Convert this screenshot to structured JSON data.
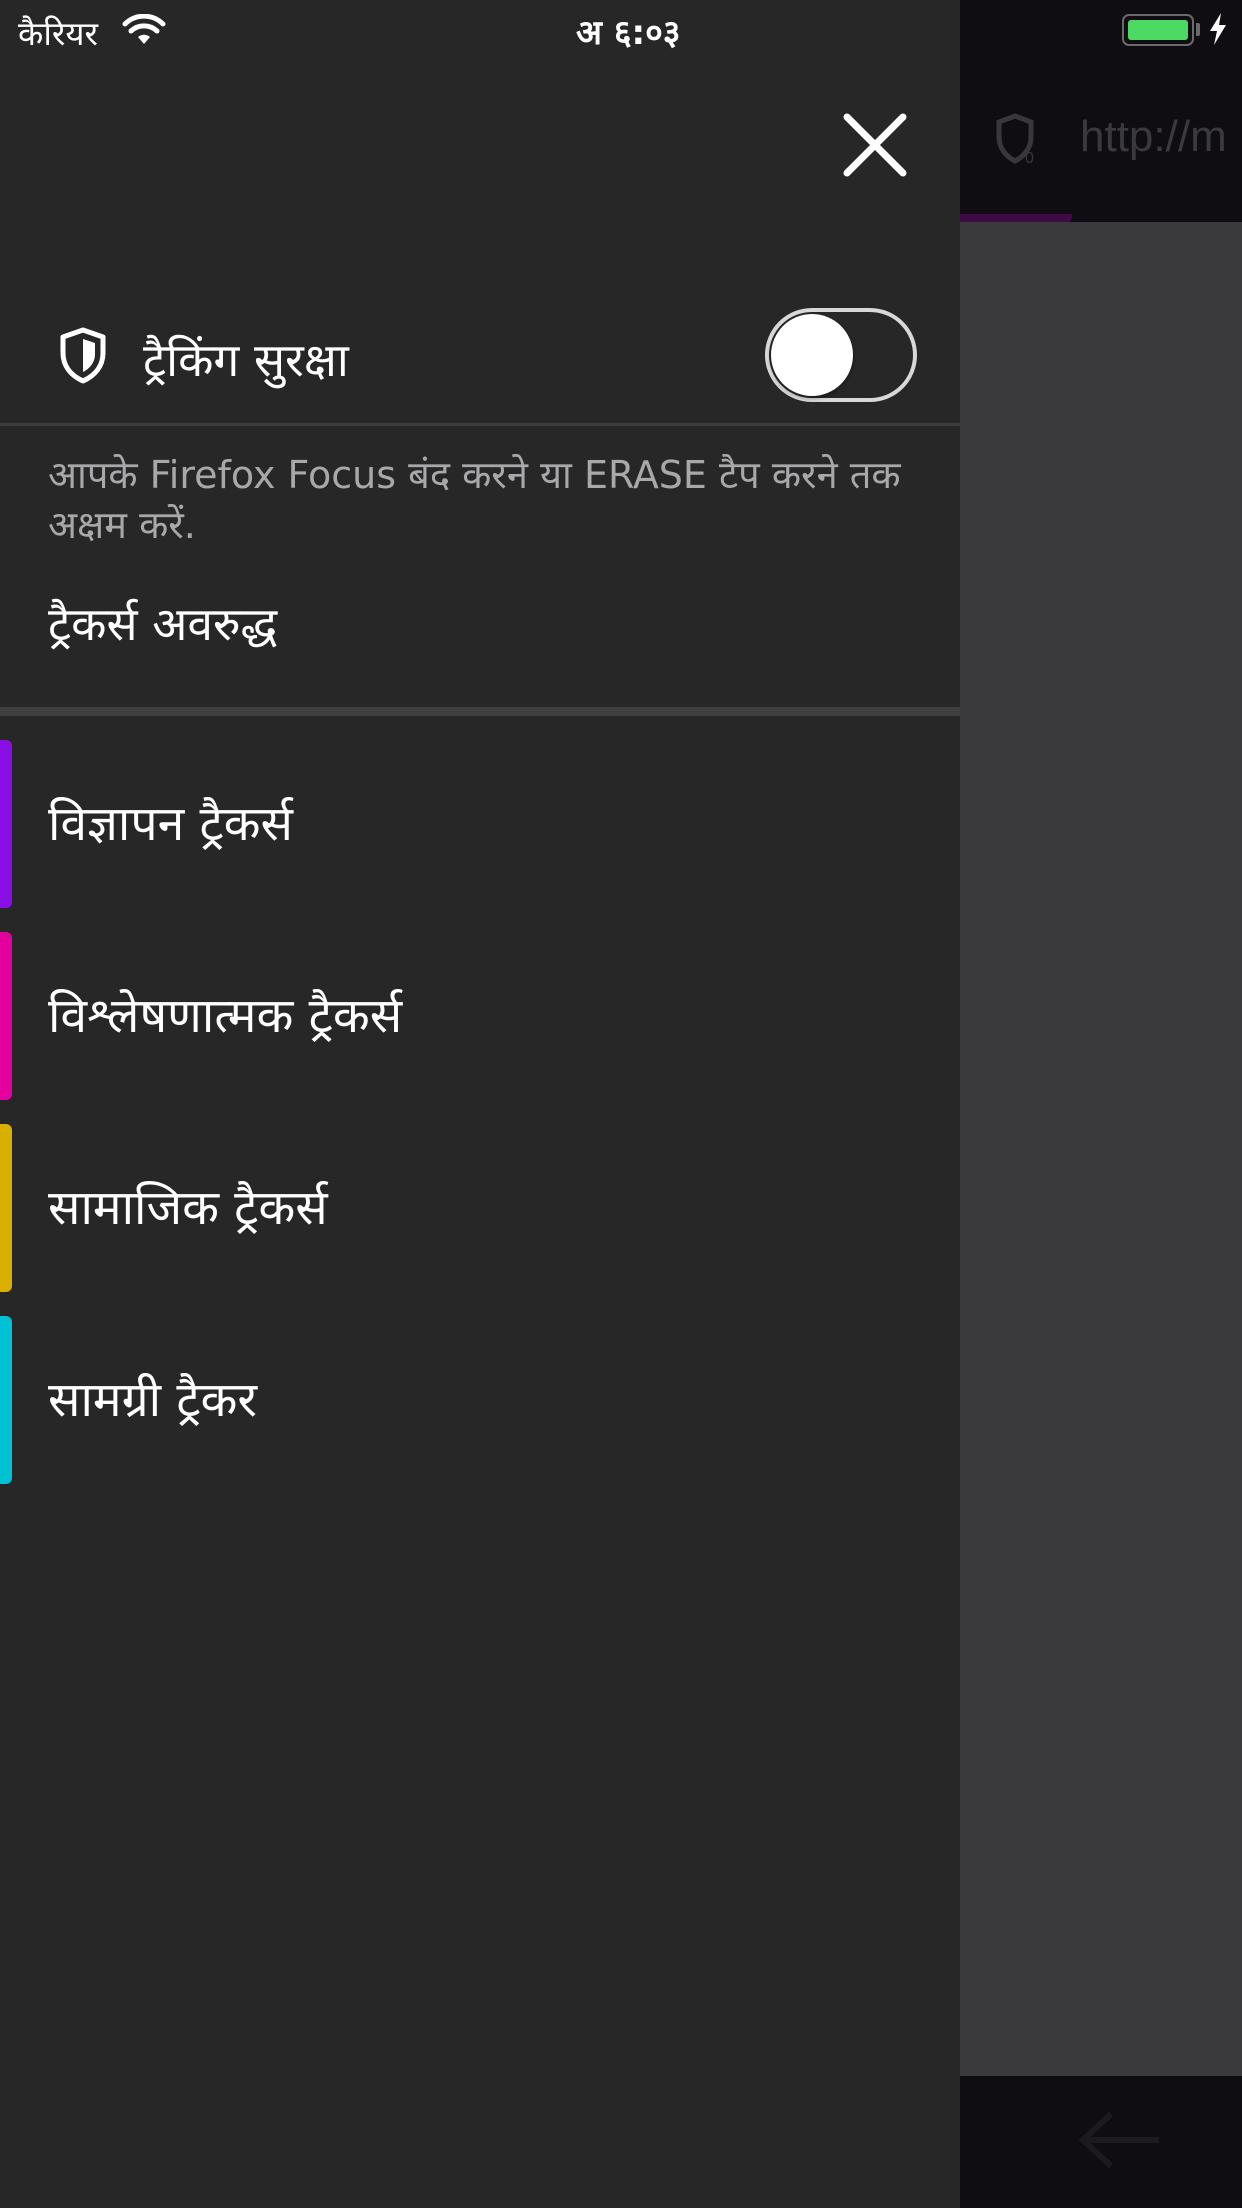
{
  "status_bar": {
    "carrier": "कैरियर",
    "time": "अ ६:०३"
  },
  "background_browser": {
    "url_text": "http://m"
  },
  "panel": {
    "tracking_protection_label": "ट्रैकिंग सुरक्षा",
    "tracking_protection_enabled": false,
    "description": "आपके Firefox Focus बंद करने या ERASE टैप करने तक अक्षम करें.",
    "trackers_blocked_label": "ट्रैकर्स अवरुद्ध",
    "trackers": [
      {
        "label": "विज्ञापन ट्रैकर्स",
        "color": "#8a0fe6"
      },
      {
        "label": "विश्लेषणात्मक ट्रैकर्स",
        "color": "#e4009f"
      },
      {
        "label": "सामाजिक ट्रैकर्स",
        "color": "#d8b100"
      },
      {
        "label": "सामग्री ट्रैकर",
        "color": "#00c2d4"
      }
    ]
  },
  "colors": {
    "panel_bg": "#272727",
    "battery": "#4cd964"
  },
  "icons": [
    "wifi-icon",
    "battery-icon",
    "charging-bolt-icon",
    "close-icon",
    "shield-icon",
    "back-arrow-icon"
  ]
}
